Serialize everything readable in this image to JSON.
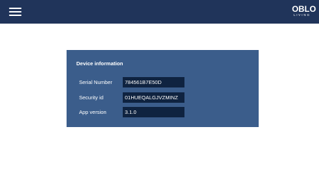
{
  "header": {
    "logo_main": "OBLO",
    "logo_sub": "LIVING"
  },
  "device_info": {
    "title": "Device information",
    "rows": [
      {
        "label": "Serial Number",
        "value": "784561B7E50D"
      },
      {
        "label": "Security id",
        "value": "01HUEQALGJVZMINZ"
      },
      {
        "label": "App version",
        "value": "3.1.0"
      }
    ]
  },
  "colors": {
    "topbar": "#20345a",
    "card": "#3b5d8b",
    "value_box": "#0f2340"
  },
  "icons": {
    "menu": "hamburger-menu-icon"
  }
}
